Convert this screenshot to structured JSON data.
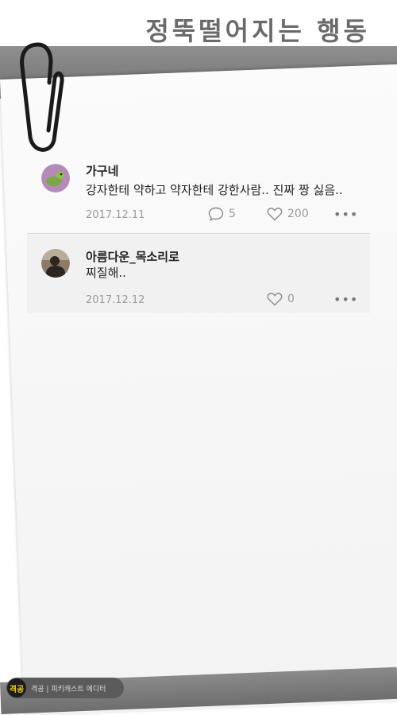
{
  "header": {
    "title": "정뚝떨어지는 행동"
  },
  "comments": [
    {
      "username": "가구네",
      "text": "강자한테 약하고 약자한테 강한사람.. 진짜 짱 싫음..",
      "date": "2017.12.11",
      "replies": "5",
      "likes": "200"
    },
    {
      "username": "아름다운_목소리로",
      "text": "찌질해..",
      "date": "2017.12.12",
      "likes": "0"
    }
  ],
  "footer": {
    "badge_logo": "격공",
    "badge_label": "격공 | 피키캐스트 에디터"
  },
  "icons": {
    "reply": "speech-bubble-icon",
    "like": "heart-icon",
    "more": "more-dots-icon",
    "clip": "paperclip-icon"
  },
  "colors": {
    "meta_text": "#9a9a9a",
    "badge_logo": "#f2d21b"
  }
}
